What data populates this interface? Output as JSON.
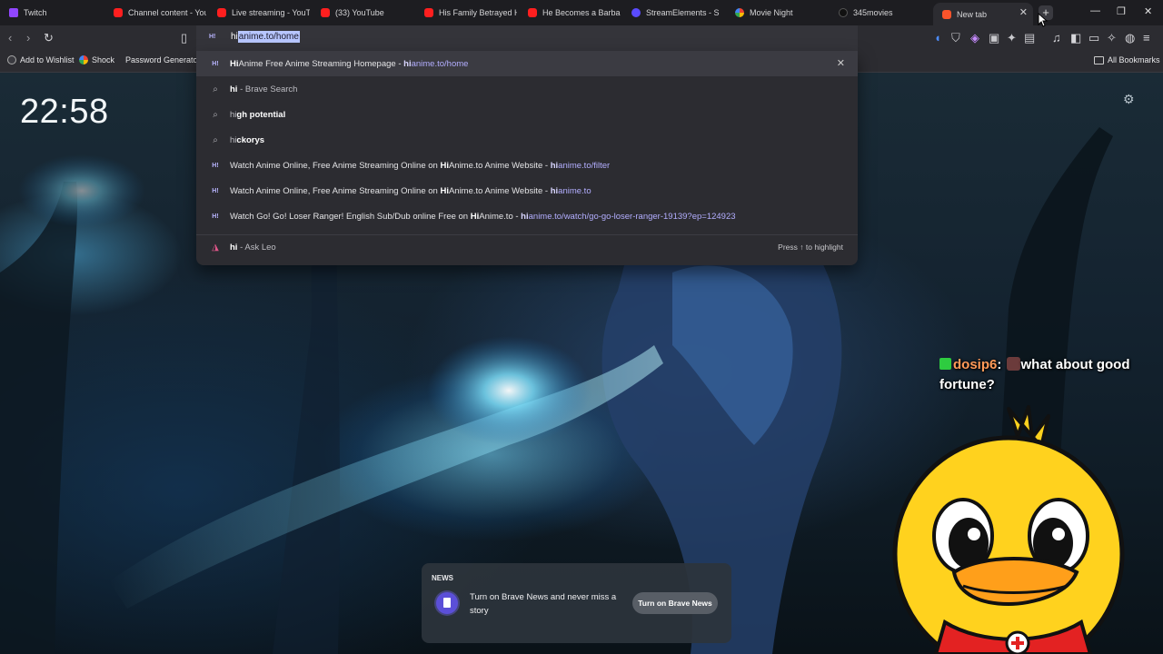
{
  "tabs": [
    {
      "label": "Twitch",
      "icon": "twitch-icon"
    },
    {
      "label": "Channel content - You",
      "icon": "youtube-icon"
    },
    {
      "label": "Live streaming - YouTu",
      "icon": "youtube-icon"
    },
    {
      "label": "(33) YouTube",
      "icon": "youtube-icon"
    },
    {
      "label": "His Family Betrayed Hi",
      "icon": "youtube-icon"
    },
    {
      "label": "He Becomes a Barbaria",
      "icon": "youtube-icon"
    },
    {
      "label": "StreamElements - S",
      "icon": "streamelements-icon"
    },
    {
      "label": "Movie Night",
      "icon": "movie-night-icon"
    },
    {
      "label": "345movies",
      "icon": "345movies-icon"
    },
    {
      "label": "New tab",
      "icon": "brave-icon"
    }
  ],
  "address_bar": {
    "typed": "hi",
    "completion": "anime.to/home"
  },
  "bookmarks": [
    {
      "label": "Add to Wishlist"
    },
    {
      "label": "Shock"
    },
    {
      "label": "Password Generator"
    }
  ],
  "all_bookmarks_label": "All Bookmarks",
  "suggestions": [
    {
      "pre": "",
      "bold": "Hi",
      "post": "Anime Free Anime Streaming Homepage - ",
      "url_bold": "hi",
      "url_rest": "anime.to/home"
    },
    {
      "pre": "",
      "bold": "hi",
      "post": " - Brave Search",
      "url_bold": "",
      "url_rest": ""
    },
    {
      "pre": "hi",
      "bold": "gh potential",
      "post": "",
      "url_bold": "",
      "url_rest": ""
    },
    {
      "pre": "hi",
      "bold": "ckorys",
      "post": "",
      "url_bold": "",
      "url_rest": ""
    },
    {
      "pre": "Watch Anime Online, Free Anime Streaming Online on ",
      "bold": "Hi",
      "post": "Anime.to Anime Website - ",
      "url_bold": "hi",
      "url_rest": "anime.to/filter"
    },
    {
      "pre": "Watch Anime Online, Free Anime Streaming Online on ",
      "bold": "Hi",
      "post": "Anime.to Anime Website - ",
      "url_bold": "hi",
      "url_rest": "anime.to"
    },
    {
      "pre": "Watch Go! Go! Loser Ranger! English Sub/Dub online Free on ",
      "bold": "Hi",
      "post": "Anime.to - ",
      "url_bold": "hi",
      "url_rest": "anime.to/watch/go-go-loser-ranger-19139?ep=124923"
    }
  ],
  "leo": {
    "query": "hi",
    "label": " - Ask Leo",
    "hint": "Press ↑ to highlight"
  },
  "clock": "22:58",
  "chat": {
    "user": "dosip6",
    "message": "what about good fortune?"
  },
  "news": {
    "title": "NEWS",
    "text": "Turn on Brave News and never miss a story",
    "button": "Turn on Brave News"
  },
  "colors": {
    "accent": "#b3aeff",
    "chat_user": "#ff9a58",
    "news_icon": "#5b4fd8"
  }
}
